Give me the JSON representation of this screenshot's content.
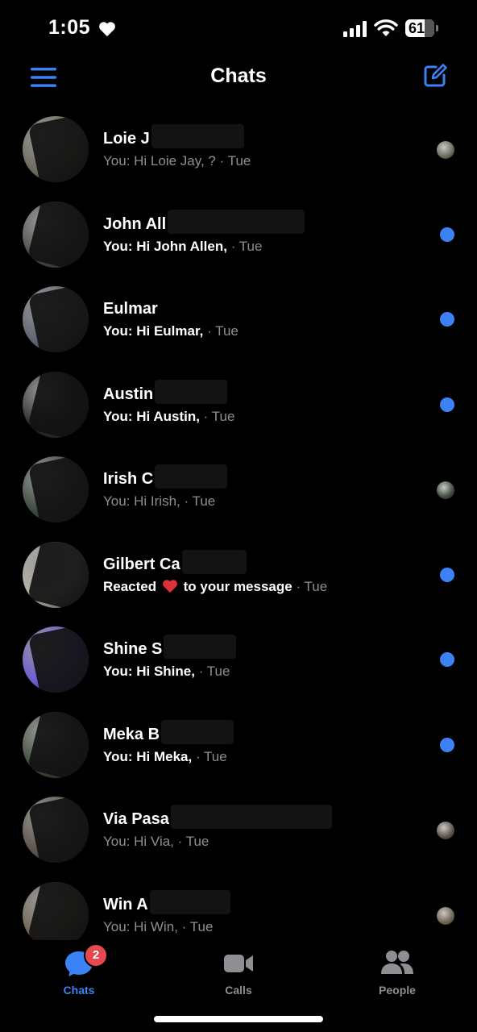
{
  "status_bar": {
    "time": "1:05",
    "battery": "61",
    "icons": [
      "heart-icon",
      "signal-icon",
      "wifi-icon",
      "battery-icon"
    ]
  },
  "header": {
    "title": "Chats",
    "menu_icon": "hamburger-menu-icon",
    "compose_icon": "compose-icon"
  },
  "colors": {
    "accent": "#3b82f6",
    "badge": "#e5484d",
    "muted": "#8e8e93",
    "background": "#000000"
  },
  "chats": [
    {
      "name": "Loie J",
      "preview": "You: Hi Loie Jay, ?",
      "time": "· Tue",
      "unread": false,
      "indicator": "seen-avatar",
      "avatar_color": "#6b6a5a",
      "mask_w": 115
    },
    {
      "name": "John All",
      "preview": "You: Hi John Allen,",
      "time": "· Tue",
      "unread": true,
      "indicator": "unread-dot",
      "avatar_color": "#4a4d45",
      "mask_w": 170
    },
    {
      "name": "Eulmar",
      "preview": "You: Hi Eulmar,",
      "time": "· Tue",
      "unread": true,
      "indicator": "unread-dot",
      "avatar_color": "#5d6470",
      "mask_w": 0
    },
    {
      "name": "Austin",
      "preview": "You: Hi Austin,",
      "time": "· Tue",
      "unread": true,
      "indicator": "unread-dot",
      "avatar_color": "#2a2a2a",
      "mask_w": 90
    },
    {
      "name": "Irish C",
      "preview": "You: Hi Irish,",
      "time": "· Tue",
      "unread": false,
      "indicator": "seen-avatar",
      "avatar_color": "#3c4a3c",
      "mask_w": 90
    },
    {
      "name": "Gilbert Ca",
      "preview": "Reacted",
      "preview_suffix": "to your message",
      "time": "· Tue",
      "unread": true,
      "indicator": "unread-dot",
      "avatar_color": "#b8b2a8",
      "mask_w": 80
    },
    {
      "name": "Shine S",
      "preview": "You: Hi Shine,",
      "time": "· Tue",
      "unread": true,
      "indicator": "unread-dot",
      "avatar_color": "#6b5bd6",
      "mask_w": 90
    },
    {
      "name": "Meka B",
      "preview": "You: Hi Meka,",
      "time": "· Tue",
      "unread": true,
      "indicator": "unread-dot",
      "avatar_color": "#3d4a35",
      "mask_w": 90
    },
    {
      "name": "Via Pasa",
      "preview": "You: Hi Via,",
      "time": "· Tue",
      "unread": false,
      "indicator": "seen-avatar",
      "avatar_color": "#5b5148",
      "mask_w": 200
    },
    {
      "name": "Win A",
      "preview": "You: Hi Win,",
      "time": "· Tue",
      "unread": false,
      "indicator": "seen-avatar",
      "avatar_color": "#6e6350",
      "mask_w": 100
    }
  ],
  "tabs": [
    {
      "label": "Chats",
      "icon": "chat-bubble-icon",
      "badge": "2",
      "active": true
    },
    {
      "label": "Calls",
      "icon": "video-camera-icon",
      "active": false
    },
    {
      "label": "People",
      "icon": "people-icon",
      "active": false
    }
  ]
}
